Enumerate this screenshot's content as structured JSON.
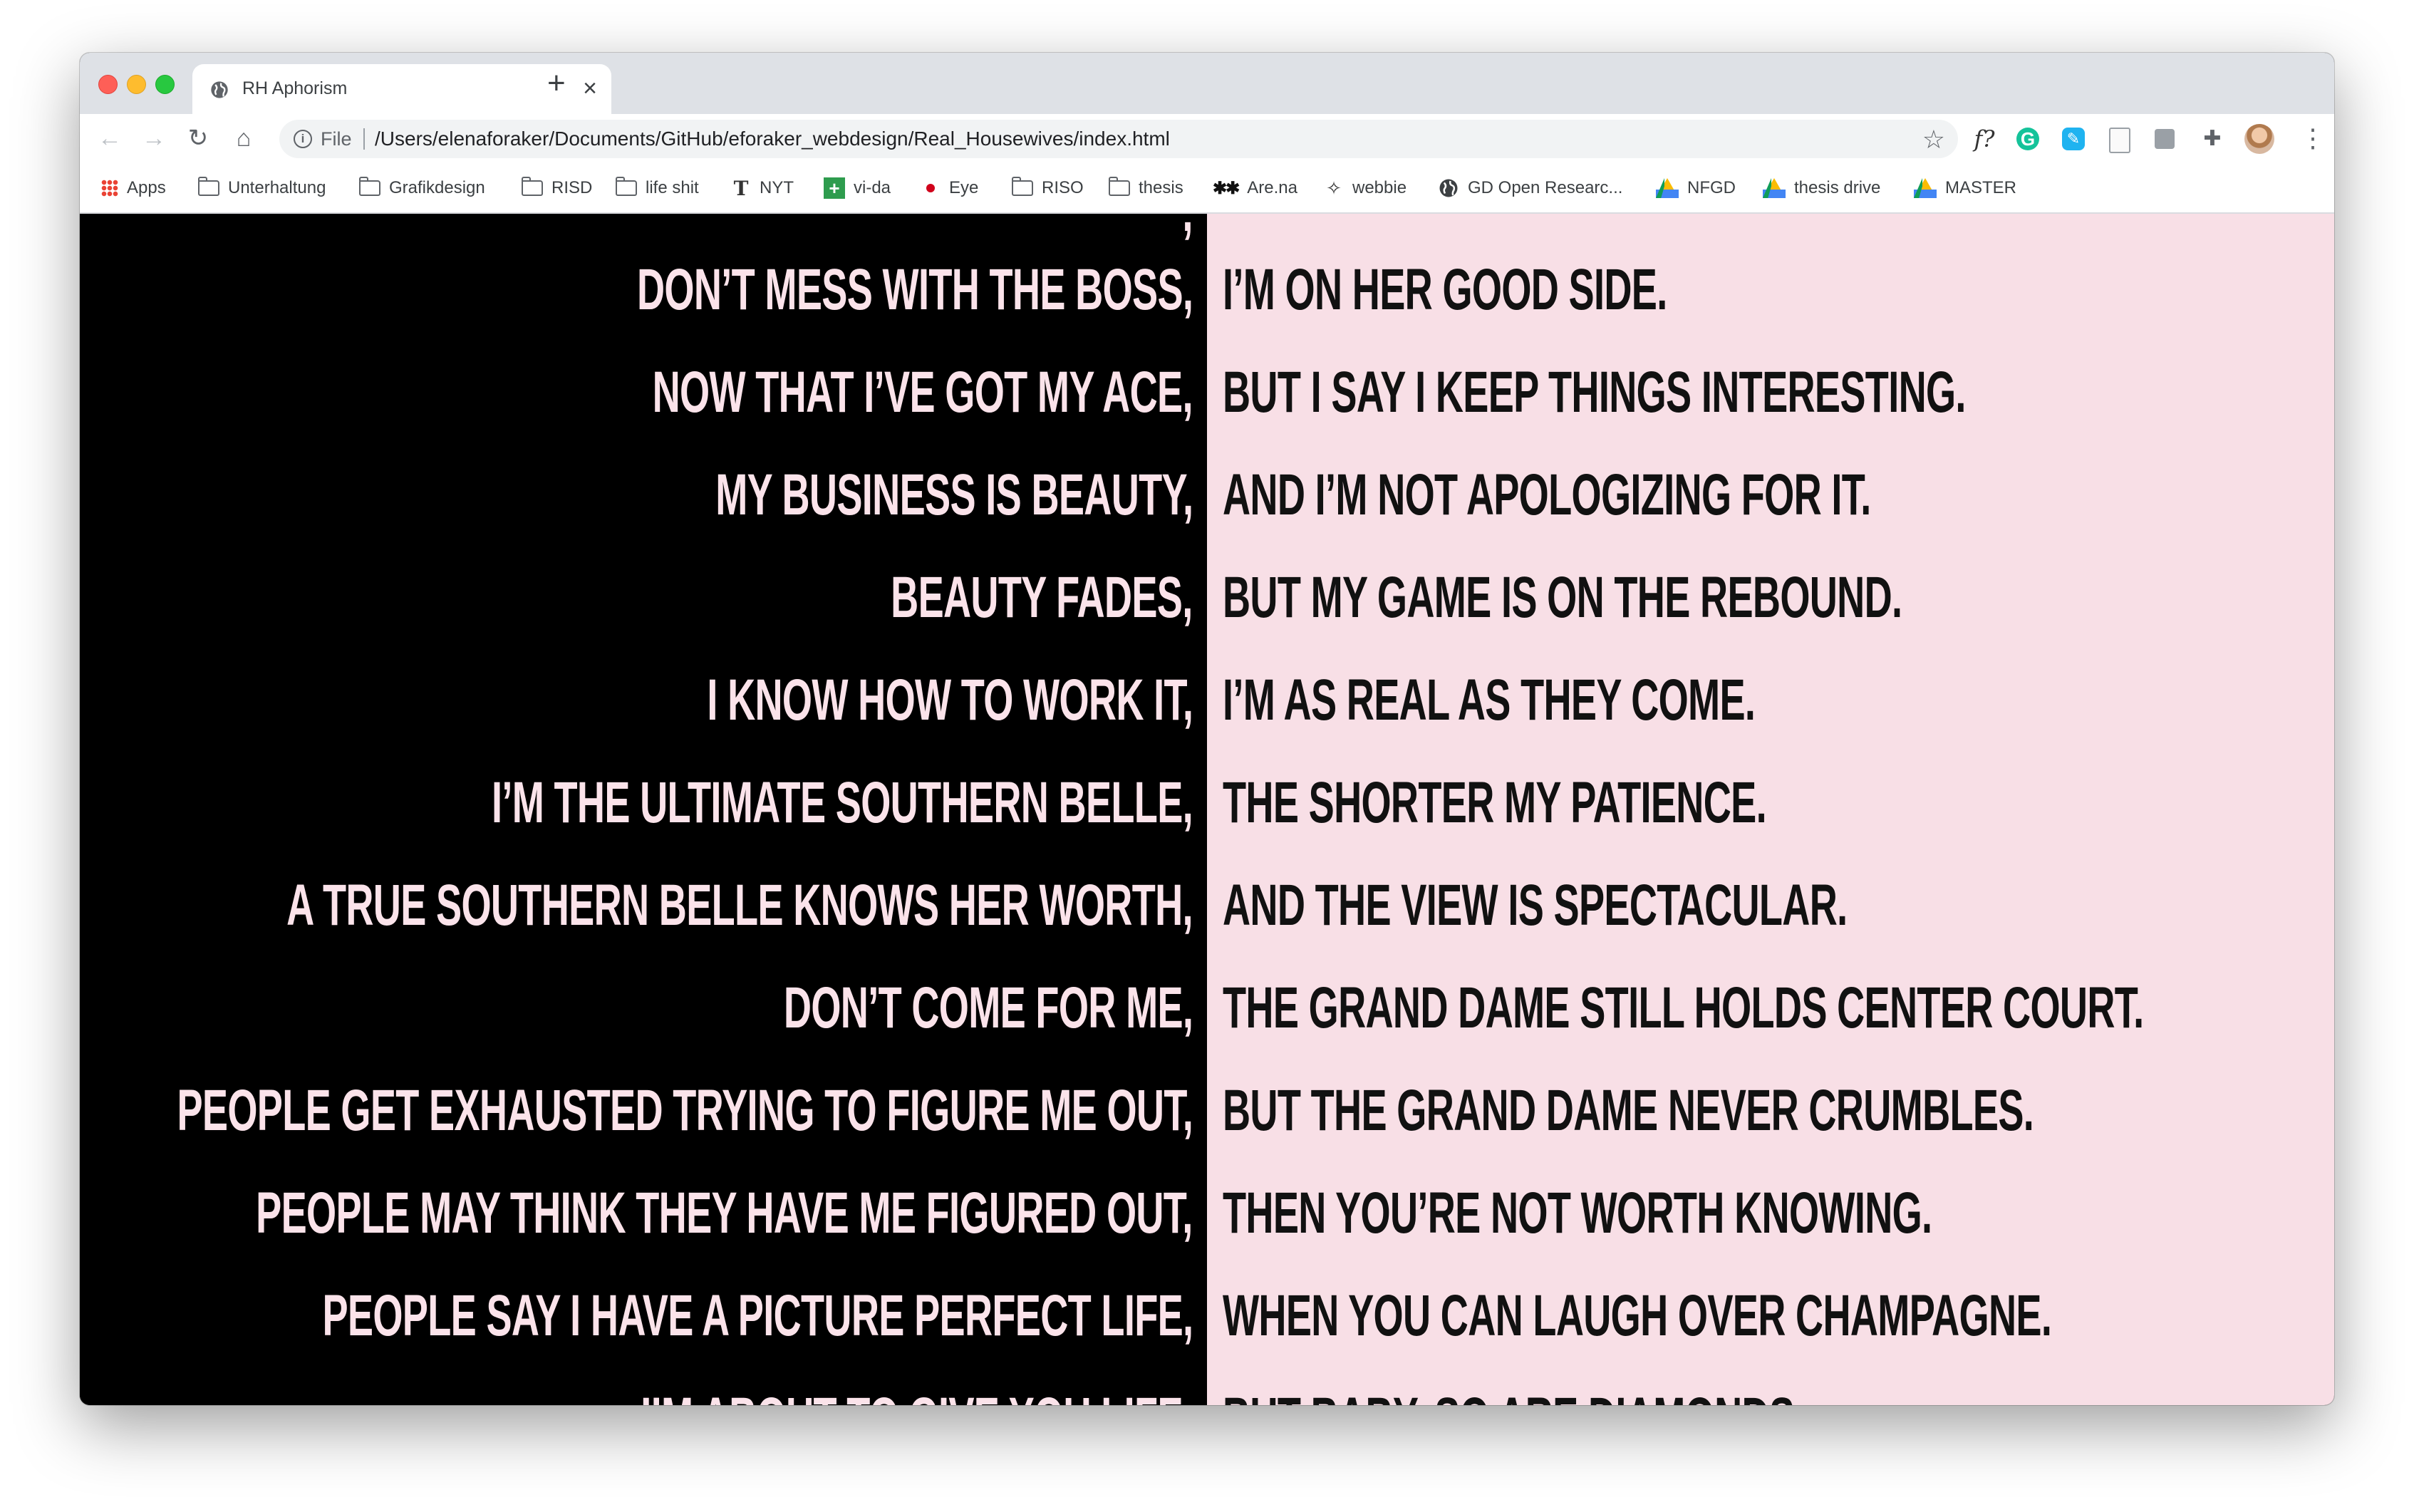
{
  "browser": {
    "tab_title": "RH Aphorism",
    "tab_close": "×",
    "new_tab": "+",
    "scheme_label": "File",
    "url": "/Users/elenaforaker/Documents/GitHub/eforaker_webdesign/Real_Housewives/index.html",
    "nav": {
      "back": "←",
      "forward": "→",
      "reload": "↻",
      "home": "⌂"
    },
    "star": "☆",
    "extensions": [
      {
        "name": "formula-extension-icon",
        "glyph": "f?"
      },
      {
        "name": "grammarly-icon",
        "glyph": "G"
      },
      {
        "name": "screencastify-icon",
        "glyph": "✎"
      },
      {
        "name": "document-extension-icon",
        "glyph": ""
      },
      {
        "name": "copy-extension-icon",
        "glyph": ""
      },
      {
        "name": "puzzle-extensions-icon",
        "glyph": "✚"
      }
    ],
    "menu": "⋮"
  },
  "bookmarks": [
    {
      "label": "Apps",
      "icon": "apps-grid-icon"
    },
    {
      "label": "Unterhaltung",
      "icon": "folder-icon"
    },
    {
      "label": "Grafikdesign",
      "icon": "folder-icon"
    },
    {
      "label": "RISD",
      "icon": "folder-icon"
    },
    {
      "label": "life shit",
      "icon": "folder-icon"
    },
    {
      "label": "NYT",
      "icon": "nyt-icon",
      "glyph": "T"
    },
    {
      "label": "vi-da",
      "icon": "vida-icon",
      "glyph": "+"
    },
    {
      "label": "Eye",
      "icon": "eye-dot-icon"
    },
    {
      "label": "RISO",
      "icon": "folder-icon"
    },
    {
      "label": "thesis",
      "icon": "folder-icon"
    },
    {
      "label": "Are.na",
      "icon": "arena-icon",
      "glyph": "✱✱"
    },
    {
      "label": "webbie",
      "icon": "sparkle-icon",
      "glyph": "✧"
    },
    {
      "label": "GD Open Researc...",
      "icon": "globe-icon"
    },
    {
      "label": "NFGD",
      "icon": "drive-icon"
    },
    {
      "label": "thesis drive",
      "icon": "drive-icon"
    },
    {
      "label": "MASTER",
      "icon": "drive-icon"
    }
  ],
  "aphorisms": {
    "top_fragment": ",",
    "left": [
      "DON’T MESS WITH THE BOSS,",
      "NOW THAT I’VE GOT MY ACE,",
      "MY BUSINESS IS BEAUTY,",
      "BEAUTY FADES,",
      "I KNOW HOW TO WORK IT,",
      "I’M THE ULTIMATE SOUTHERN BELLE,",
      "A TRUE SOUTHERN BELLE KNOWS HER WORTH,",
      "DON’T COME FOR ME,",
      "PEOPLE GET EXHAUSTED TRYING TO FIGURE ME OUT,",
      "PEOPLE MAY THINK THEY HAVE ME FIGURED OUT,",
      "PEOPLE SAY I HAVE A PICTURE PERFECT LIFE,",
      "I’M ABOUT TO GIVE YOU LIFE,"
    ],
    "right": [
      "I’M ON HER GOOD SIDE.",
      "BUT I SAY I KEEP THINGS INTERESTING.",
      "AND I’M NOT APOLOGIZING FOR IT.",
      "BUT MY GAME IS ON THE REBOUND.",
      "I’M AS REAL AS THEY COME.",
      "THE SHORTER MY PATIENCE.",
      "AND THE VIEW IS SPECTACULAR.",
      "THE GRAND DAME STILL HOLDS CENTER COURT.",
      "BUT THE GRAND DAME NEVER CRUMBLES.",
      "THEN YOU’RE NOT WORTH KNOWING.",
      "WHEN YOU CAN LAUGH OVER CHAMPAGNE.",
      "BUT BABY, SO ARE DIAMONDS."
    ]
  },
  "colors": {
    "left_bg": "#000000",
    "left_text": "#fbe3ea",
    "right_bg": "#f8dfe6",
    "right_text": "#111111"
  }
}
